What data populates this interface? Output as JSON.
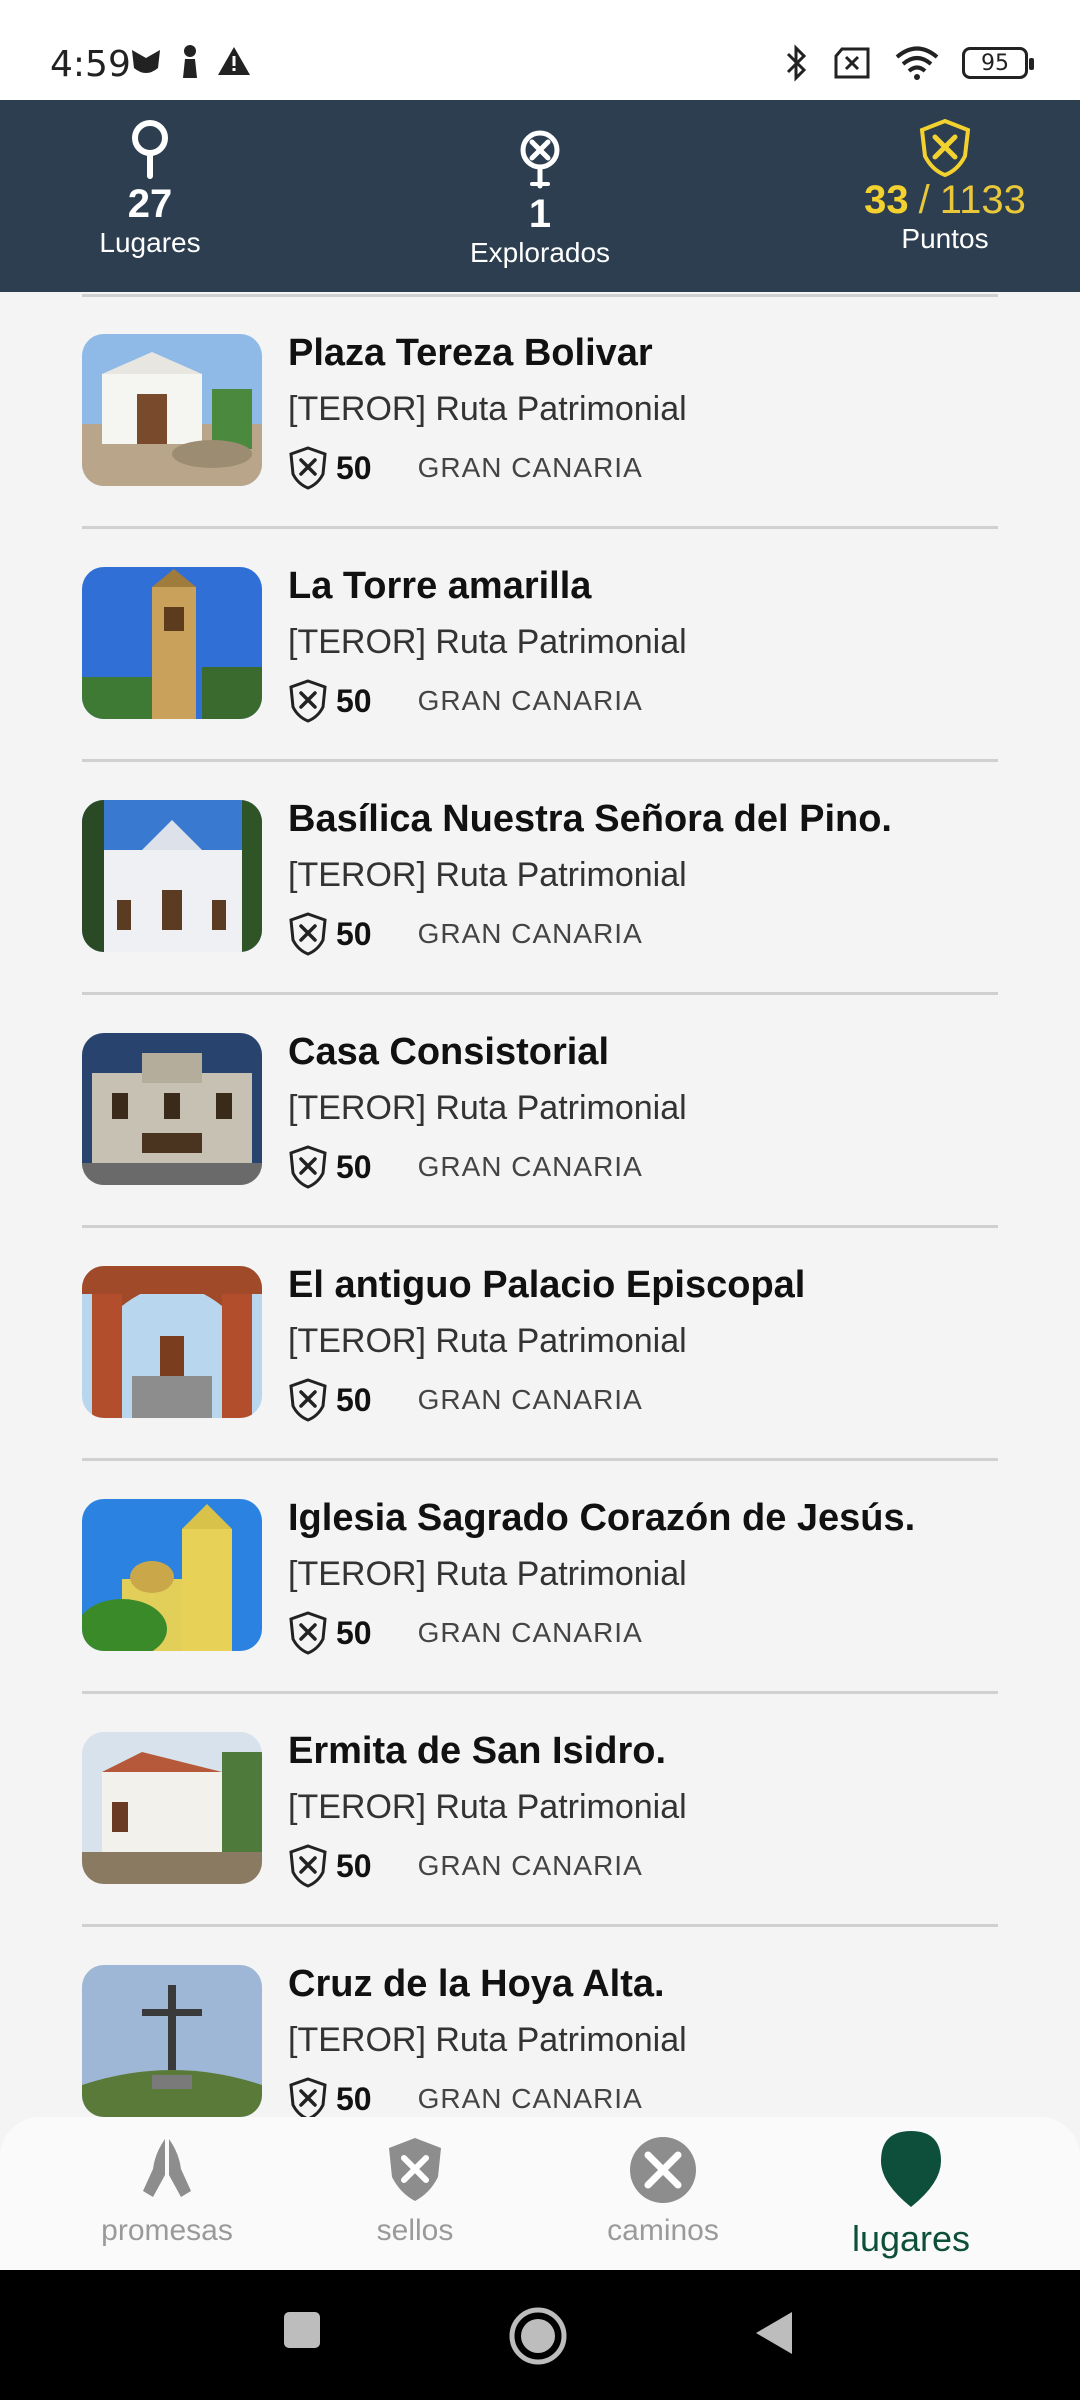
{
  "status_bar": {
    "time": "4:59",
    "battery": "95"
  },
  "stats": {
    "lugares": {
      "value": "27",
      "label": "Lugares"
    },
    "explorados": {
      "value": "1",
      "label": "Explorados"
    },
    "puntos": {
      "current": "33",
      "separator": "/",
      "total": "1133",
      "label": "Puntos"
    }
  },
  "places": [
    {
      "title": "Plaza Tereza Bolivar",
      "route": "[TEROR] Ruta Patrimonial",
      "points": "50",
      "region": "GRAN CANARIA"
    },
    {
      "title": "La Torre amarilla",
      "route": "[TEROR] Ruta Patrimonial",
      "points": "50",
      "region": "GRAN CANARIA"
    },
    {
      "title": "Basílica Nuestra Señora del Pino.",
      "route": "[TEROR] Ruta Patrimonial",
      "points": "50",
      "region": "GRAN CANARIA"
    },
    {
      "title": "Casa Consistorial",
      "route": "[TEROR] Ruta Patrimonial",
      "points": "50",
      "region": "GRAN CANARIA"
    },
    {
      "title": "El antiguo Palacio Episcopal",
      "route": "[TEROR] Ruta Patrimonial",
      "points": "50",
      "region": "GRAN CANARIA"
    },
    {
      "title": "Iglesia Sagrado Corazón de Jesús.",
      "route": "[TEROR] Ruta Patrimonial",
      "points": "50",
      "region": "GRAN CANARIA"
    },
    {
      "title": "Ermita de San Isidro.",
      "route": "[TEROR] Ruta Patrimonial",
      "points": "50",
      "region": "GRAN CANARIA"
    },
    {
      "title": "Cruz de la Hoya Alta.",
      "route": "[TEROR] Ruta Patrimonial",
      "points": "50",
      "region": "GRAN CANARIA"
    }
  ],
  "bottom_nav": {
    "promesas": "promesas",
    "sellos": "sellos",
    "caminos": "caminos",
    "lugares": "lugares",
    "active": "lugares"
  },
  "colors": {
    "header_bg": "#2c3e50",
    "accent_yellow": "#f3d22f",
    "active_green": "#0d4f3a"
  }
}
